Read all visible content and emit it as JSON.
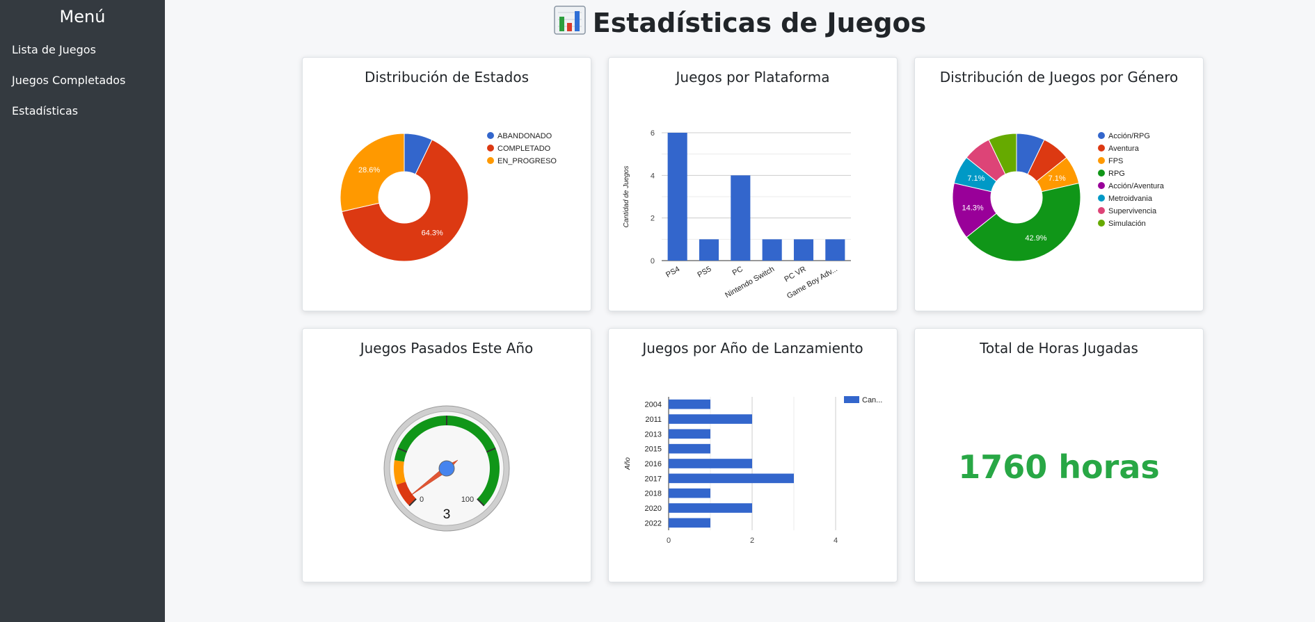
{
  "sidebar": {
    "title": "Menú",
    "items": [
      {
        "label": "Lista de Juegos"
      },
      {
        "label": "Juegos Completados"
      },
      {
        "label": "Estadísticas"
      }
    ]
  },
  "header": {
    "title": "Estadísticas de Juegos",
    "icon": "bar-chart-icon"
  },
  "colors": {
    "blue": "#3366cc",
    "red": "#dc3912",
    "orange": "#ff9900",
    "green": "#109618",
    "purple": "#990099",
    "cyan": "#0099c6",
    "pink": "#dd4477",
    "lime": "#66aa00",
    "hours_green": "#28a745"
  },
  "chart_data": [
    {
      "type": "pie",
      "title": "Distribución de Estados",
      "donut": true,
      "legend_position": "right",
      "categories": [
        "ABANDONADO",
        "COMPLETADO",
        "EN_PROGRESO"
      ],
      "values": [
        1,
        9,
        4
      ],
      "slice_labels": [
        "",
        "64.3%",
        "28.6%"
      ],
      "colors": [
        "#3366cc",
        "#dc3912",
        "#ff9900"
      ]
    },
    {
      "type": "bar",
      "title": "Juegos por Plataforma",
      "ylabel": "Cantidad de Juegos",
      "categories": [
        "PS4",
        "PS5",
        "PC",
        "Nintendo Switch",
        "PC VR",
        "Game Boy Adv..."
      ],
      "values": [
        6,
        1,
        4,
        1,
        1,
        1
      ],
      "ylim": [
        0,
        6
      ],
      "yticks": [
        "0",
        "2",
        "4",
        "6"
      ],
      "grid": true
    },
    {
      "type": "pie",
      "title": "Distribución de Juegos por Género",
      "donut": true,
      "legend_position": "right",
      "categories": [
        "Acción/RPG",
        "Aventura",
        "FPS",
        "RPG",
        "Acción/Aventura",
        "Metroidvania",
        "Supervivencia",
        "Simulación"
      ],
      "values": [
        1,
        1,
        1,
        6,
        2,
        1,
        1,
        1
      ],
      "slice_labels": [
        "",
        "",
        "7.1%",
        "42.9%",
        "14.3%",
        "7.1%",
        "",
        ""
      ],
      "colors": [
        "#3366cc",
        "#dc3912",
        "#ff9900",
        "#109618",
        "#990099",
        "#0099c6",
        "#dd4477",
        "#66aa00"
      ]
    },
    {
      "type": "gauge",
      "title": "Juegos Pasados Este Año",
      "value": 3,
      "value_label": "3",
      "min_label": "0",
      "max_label": "100",
      "range": [
        0,
        100
      ]
    },
    {
      "type": "bar",
      "orientation": "horizontal",
      "title": "Juegos por Año de Lanzamiento",
      "ylabel": "Año",
      "categories": [
        "2004",
        "2011",
        "2013",
        "2015",
        "2016",
        "2017",
        "2018",
        "2020",
        "2022"
      ],
      "values": [
        1,
        2,
        1,
        1,
        2,
        3,
        1,
        2,
        1
      ],
      "xlim": [
        0,
        4
      ],
      "xticks": [
        "0",
        "2",
        "4"
      ],
      "legend": "Can...",
      "grid": true
    }
  ],
  "hours": {
    "title": "Total de Horas Jugadas",
    "value": "1760 horas"
  }
}
